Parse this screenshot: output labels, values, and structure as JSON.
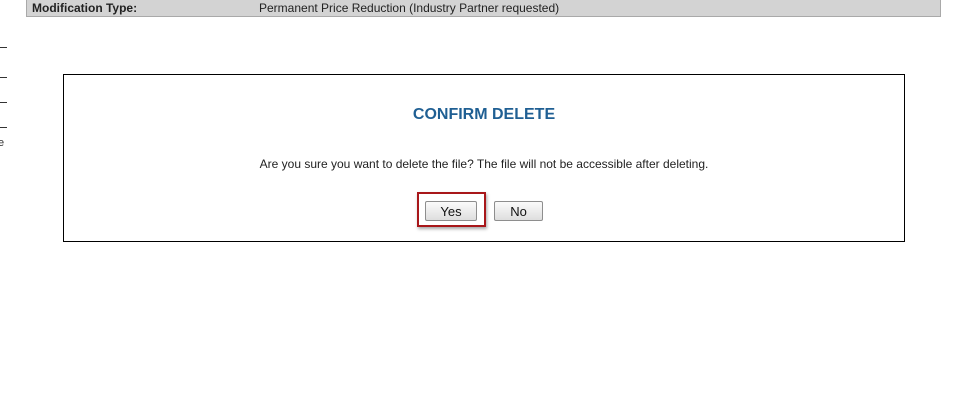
{
  "modification": {
    "label": "Modification Type:",
    "value": "Permanent Price Reduction (Industry Partner requested)"
  },
  "left_edge": {
    "glyph": "e"
  },
  "dialog": {
    "title": "CONFIRM DELETE",
    "message": "Are you sure you want to delete the file? The file will not be accessible after deleting.",
    "yes_label": "Yes",
    "no_label": "No"
  },
  "colors": {
    "title": "#1f5f93",
    "highlight": "#a8171a",
    "bar_background": "#d3d3d3"
  }
}
